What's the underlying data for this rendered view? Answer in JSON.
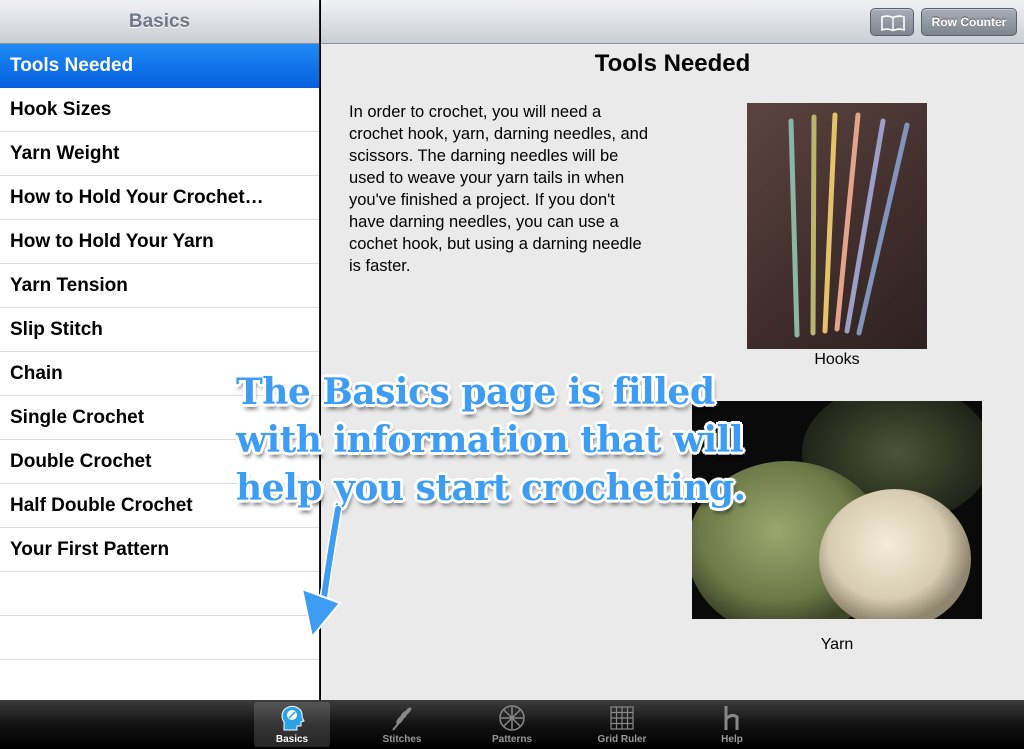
{
  "sidebar": {
    "title": "Basics",
    "items": [
      {
        "label": "Tools Needed"
      },
      {
        "label": "Hook Sizes"
      },
      {
        "label": "Yarn Weight"
      },
      {
        "label": "How to Hold Your Crochet…"
      },
      {
        "label": "How to Hold Your Yarn"
      },
      {
        "label": "Yarn Tension"
      },
      {
        "label": "Slip Stitch"
      },
      {
        "label": "Chain"
      },
      {
        "label": "Single Crochet"
      },
      {
        "label": "Double Crochet"
      },
      {
        "label": "Half Double Crochet"
      },
      {
        "label": "Your First Pattern"
      }
    ]
  },
  "toolbar": {
    "book_icon": "book-icon",
    "row_counter_label": "Row Counter"
  },
  "content": {
    "title": "Tools Needed",
    "paragraph": "In order to crochet, you will need a crochet hook, yarn, darning needles, and scissors. The darning needles will be used to weave your yarn tails in when you've finished a project. If you don't have darning needles, you can use a cochet hook, but using a darning needle is faster.",
    "hooks_caption": "Hooks",
    "yarn_caption": "Yarn"
  },
  "annotation": {
    "text": "The Basics page is filled with information that will help you start crocheting.",
    "color": "#3d9df5"
  },
  "tabbar": {
    "tabs": [
      {
        "label": "Basics",
        "icon": "head-icon",
        "active": true
      },
      {
        "label": "Stitches",
        "icon": "wheat-icon",
        "active": false
      },
      {
        "label": "Patterns",
        "icon": "snowflake-icon",
        "active": false
      },
      {
        "label": "Grid Ruler",
        "icon": "grid-icon",
        "active": false
      },
      {
        "label": "Help",
        "icon": "help-h-icon",
        "active": false
      }
    ]
  },
  "colors": {
    "selected_row": "#0a6ae8",
    "content_bg": "#eaeaea",
    "tabbar_bg": "#1a1a1a"
  }
}
